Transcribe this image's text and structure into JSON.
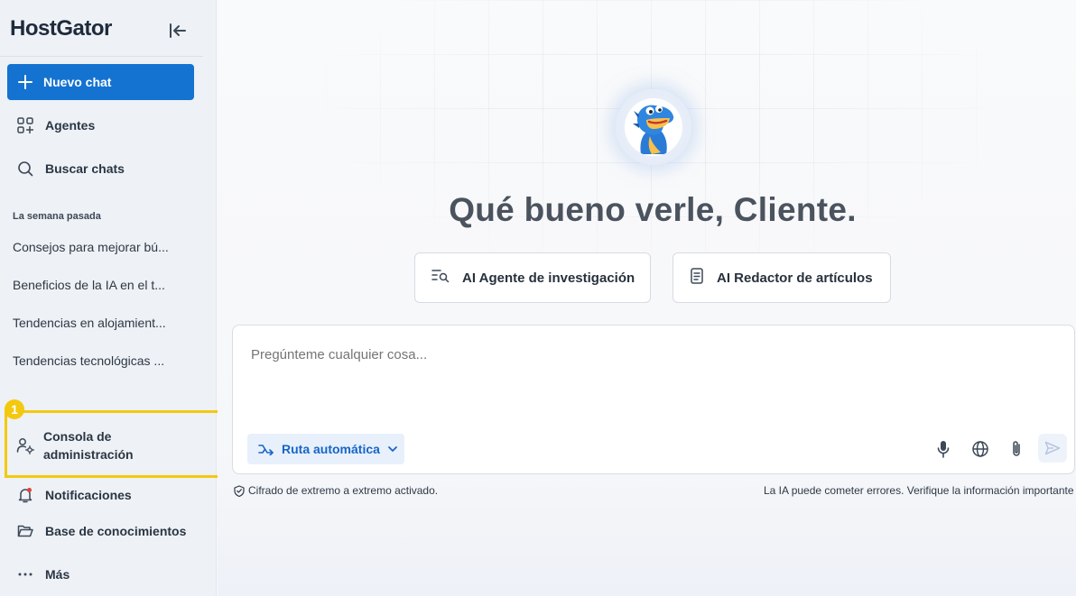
{
  "brand": {
    "name": "HostGator"
  },
  "sidebar": {
    "new_chat_label": "Nuevo chat",
    "agents_label": "Agentes",
    "search_label": "Buscar chats",
    "section_label": "La semana pasada",
    "history": [
      "Consejos para mejorar bú...",
      "Beneficios de la IA en el t...",
      "Tendencias en alojamient...",
      "Tendencias tecnológicas ..."
    ],
    "admin_badge": "1",
    "admin_label": "Consola de administración",
    "notifications_label": "Notificaciones",
    "knowledge_label": "Base de conocimientos",
    "more_label": "Más"
  },
  "main": {
    "greeting": "Qué bueno verle, Cliente.",
    "agents": [
      {
        "label": "AI Agente de investigación",
        "icon": "research-icon"
      },
      {
        "label": "AI Redactor de artículos",
        "icon": "document-icon"
      }
    ],
    "composer": {
      "placeholder": "Pregúnteme cualquier cosa...",
      "route_label": "Ruta automática"
    },
    "footer_left": "Cifrado de extremo a extremo activado.",
    "footer_right": "La IA puede cometer errores. Verifique la información importante"
  },
  "colors": {
    "primary": "#1473d1",
    "highlight": "#f3c90f",
    "sidebar_bg": "#eef1f5"
  }
}
